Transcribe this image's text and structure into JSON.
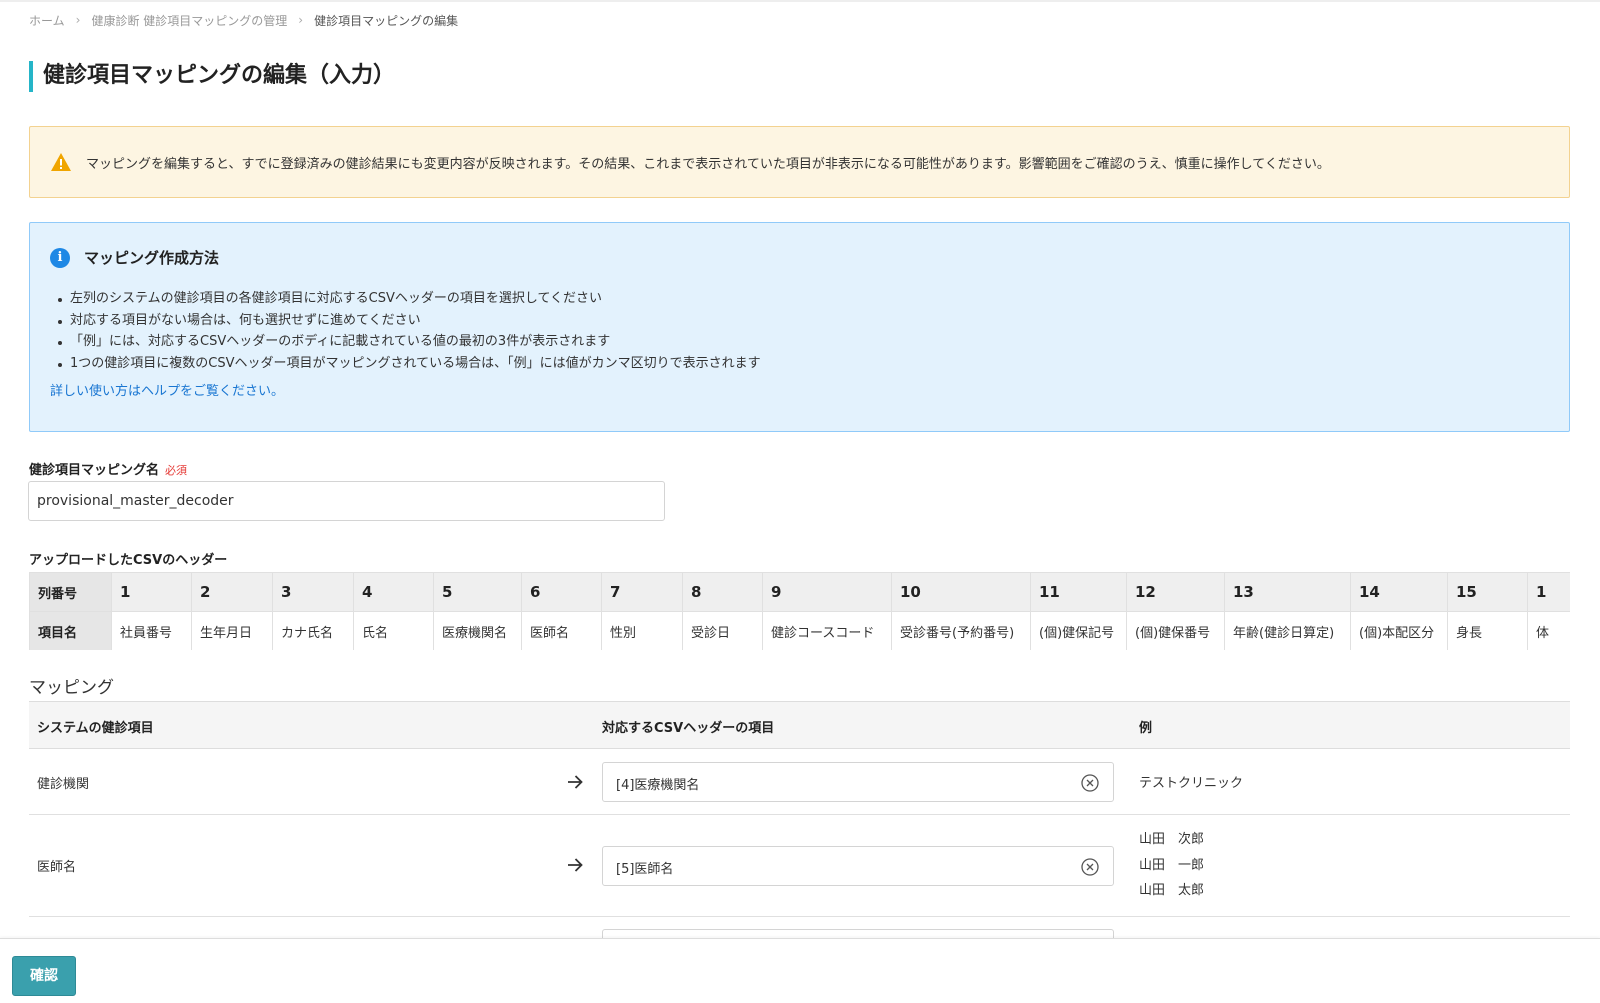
{
  "breadcrumb": {
    "items": [
      "ホーム",
      "健康診断 健診項目マッピングの管理"
    ],
    "current": "健診項目マッピングの編集"
  },
  "page_title": "健診項目マッピングの編集（入力）",
  "warning": {
    "icon": "warning-triangle-icon",
    "color": "#f0a500",
    "text": "マッピングを編集すると、すでに登録済みの健診結果にも変更内容が反映されます。その結果、これまで表示されていた項目が非表示になる可能性があります。影響範囲をご確認のうえ、慎重に操作してください。"
  },
  "info": {
    "icon": "info-icon",
    "title": "マッピング作成方法",
    "items": [
      "左列のシステムの健診項目の各健診項目に対応するCSVヘッダーの項目を選択してください",
      "対応する項目がない場合は、何も選択せずに進めてください",
      "「例」には、対応するCSVヘッダーのボディに記載されている値の最初の3件が表示されます",
      "1つの健診項目に複数のCSVヘッダー項目がマッピングされている場合は、「例」には値がカンマ区切りで表示されます"
    ],
    "help_link": "詳しい使い方はヘルプをご覧ください。"
  },
  "mapping_name": {
    "label": "健診項目マッピング名",
    "required_label": "必須",
    "value": "provisional_master_decoder"
  },
  "csv_header": {
    "title": "アップロードしたCSVのヘッダー",
    "row_label_number": "列番号",
    "row_label_name": "項目名",
    "numbers": [
      "1",
      "2",
      "3",
      "4",
      "5",
      "6",
      "7",
      "8",
      "9",
      "10",
      "11",
      "12",
      "13",
      "14",
      "15",
      "1"
    ],
    "names": [
      "社員番号",
      "生年月日",
      "カナ氏名",
      "氏名",
      "医療機関名",
      "医師名",
      "性別",
      "受診日",
      "健診コースコード",
      "受診番号(予約番号)",
      "(個)健保記号",
      "(個)健保番号",
      "年齢(健診日算定)",
      "(個)本配区分",
      "身長",
      "体"
    ]
  },
  "mapping": {
    "title": "マッピング",
    "headers": {
      "system_item": "システムの健診項目",
      "csv_item": "対応するCSVヘッダーの項目",
      "example": "例"
    },
    "rows": [
      {
        "system": "健診機関",
        "selected": "[4]医療機関名",
        "examples": [
          "テストクリニック"
        ]
      },
      {
        "system": "医師名",
        "selected": "[5]医師名",
        "examples": [
          "山田　次郎",
          "山田　一郎",
          "山田　太郎"
        ]
      }
    ]
  },
  "footer": {
    "confirm_label": "確認"
  },
  "colors": {
    "accent": "#25b5c8",
    "button": "#3aa0ad",
    "info_bg": "#e3f2fd",
    "warning_bg": "#fdf5e2",
    "required": "#e53935",
    "link": "#1976d2"
  }
}
